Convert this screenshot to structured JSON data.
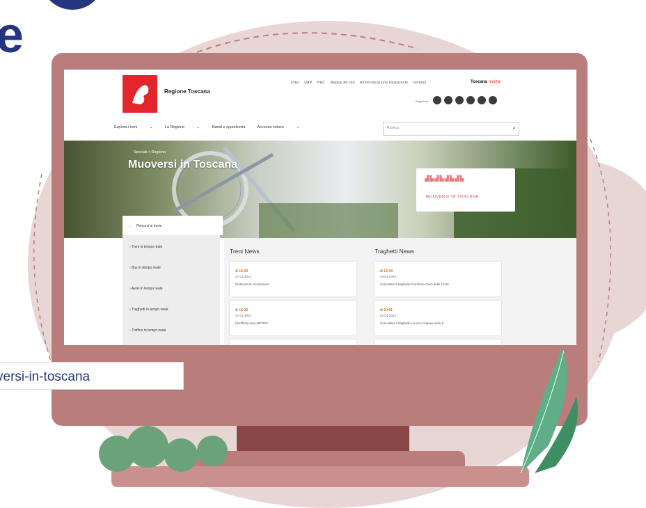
{
  "url_bar": {
    "text": "versi-in-toscana"
  },
  "website": {
    "site_name": "Regione Toscana",
    "utility_links": [
      "Urbo",
      "URP",
      "PEC",
      "Mappa del sito",
      "Amministrazione trasparente",
      "Intranet"
    ],
    "brand": {
      "name": "Toscana",
      "suffix": "notizie"
    },
    "follow_label": "Seguici su",
    "social_icons": [
      "facebook-icon",
      "twitter-icon",
      "instagram-icon",
      "youtube-icon",
      "linkedin-icon",
      "telegram-icon"
    ],
    "nav": [
      "Esplora i temi",
      "La Regione",
      "Bandi e opportunità",
      "Accesso veloce"
    ],
    "search_placeholder": "Ricerca",
    "hero": {
      "breadcrumb": "Speciali > Regione",
      "title": "Muoversi in Toscana",
      "sign_text": "MUOVERSI IN TOSCANA"
    },
    "sidebar_items": [
      "Percorsi in treno",
      "Treni in tempo reale",
      "Bus in tempo reale",
      "Aerei in tempo reale",
      "Traghetti in tempo reale",
      "Traffico in tempo reale"
    ],
    "treni_news": {
      "title": "Treni News",
      "items": [
        {
          "time": "15:30",
          "date": "27-01-2022",
          "text": "Riattivata la circolazione"
        },
        {
          "time": "15:20",
          "date": "27-01-2022",
          "text": "Modifiche treni METRO"
        }
      ]
    },
    "traghetti_news": {
      "title": "Traghetti News",
      "items": [
        {
          "time": "12:44",
          "date": "24-01-2022",
          "text": "Cancellato il traghetto Piombino-Cavo delle 13:55"
        },
        {
          "time": "10:01",
          "date": "21-01-2022",
          "text": "Cancellato il traghetto Livorno-Capraia delle 8"
        }
      ]
    }
  }
}
